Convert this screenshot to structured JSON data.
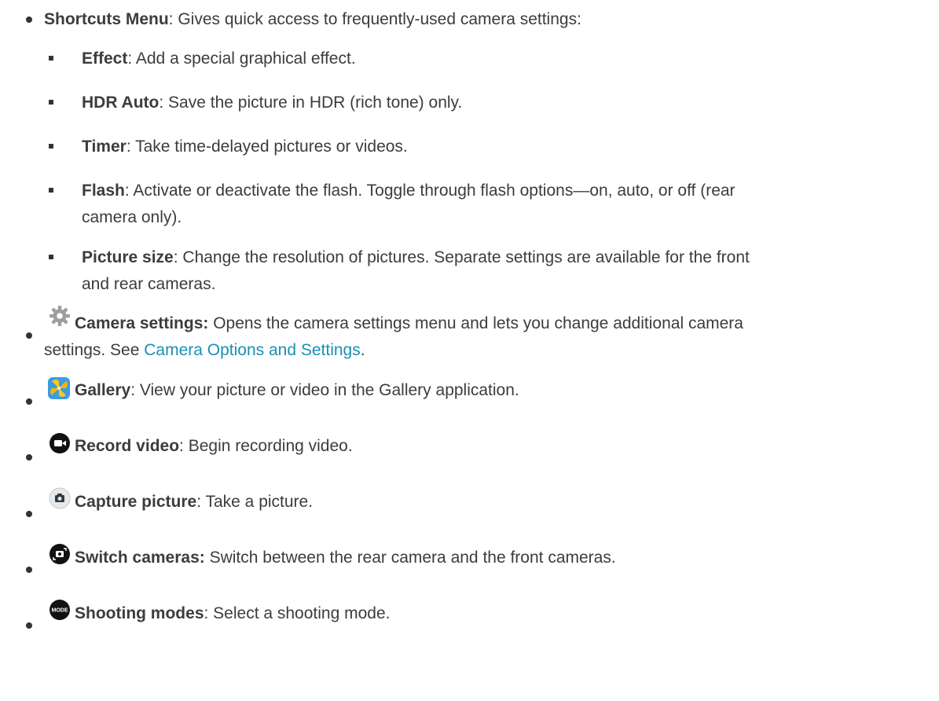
{
  "items": [
    {
      "bold": "Shortcuts Menu",
      "text": ": Gives quick access to frequently-used camera settings:"
    },
    {
      "bold": "Effect",
      "text": ": Add a special graphical effect."
    },
    {
      "bold": "HDR Auto",
      "text": ": Save the picture in HDR (rich tone) only."
    },
    {
      "bold": "Timer",
      "text": ": Take time-delayed pictures or videos."
    },
    {
      "bold": "Flash",
      "text": ": Activate or deactivate the flash. Toggle through flash options—on, auto, or off (rear",
      "text2": "camera only)."
    },
    {
      "bold": "Picture size",
      "text": ": Change the resolution of pictures. Separate settings are available for the front",
      "text2": "and rear cameras."
    },
    {
      "bold": "Camera settings:",
      "text": " Opens the camera settings menu and lets you change additional camera",
      "text2a": "settings. See ",
      "link": "Camera Options and Settings",
      "text2b": "."
    },
    {
      "bold": "Gallery",
      "text": ": View your picture or video in the Gallery application."
    },
    {
      "bold": "Record video",
      "text": ": Begin recording video."
    },
    {
      "bold": "Capture picture",
      "text": ": Take a picture."
    },
    {
      "bold": "Switch cameras:",
      "text": " Switch between the rear camera and the front cameras."
    },
    {
      "bold": "Shooting modes",
      "text": ": Select a shooting mode."
    }
  ],
  "icons": {
    "settings": "gear-icon",
    "gallery": "gallery-icon",
    "record": "record-video-icon",
    "capture": "camera-icon",
    "switch": "switch-camera-icon",
    "mode": "mode-icon",
    "mode_text": "MODE"
  }
}
